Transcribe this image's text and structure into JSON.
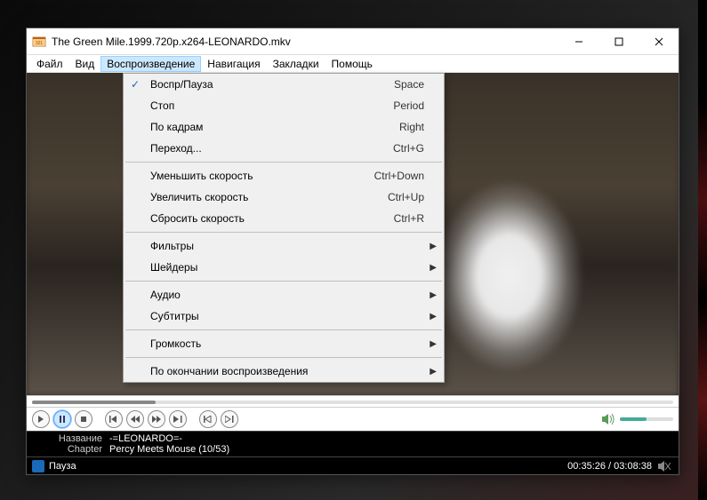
{
  "window": {
    "title": "The Green Mile.1999.720p.x264-LEONARDO.mkv"
  },
  "menubar": {
    "items": [
      {
        "label": "Файл"
      },
      {
        "label": "Вид"
      },
      {
        "label": "Воспроизведение",
        "open": true
      },
      {
        "label": "Навигация"
      },
      {
        "label": "Закладки"
      },
      {
        "label": "Помощь"
      }
    ]
  },
  "dropdown": {
    "groups": [
      [
        {
          "label": "Воспр/Пауза",
          "shortcut": "Space",
          "checked": true
        },
        {
          "label": "Стоп",
          "shortcut": "Period"
        },
        {
          "label": "По кадрам",
          "shortcut": "Right"
        },
        {
          "label": "Переход...",
          "shortcut": "Ctrl+G"
        }
      ],
      [
        {
          "label": "Уменьшить скорость",
          "shortcut": "Ctrl+Down"
        },
        {
          "label": "Увеличить скорость",
          "shortcut": "Ctrl+Up"
        },
        {
          "label": "Сбросить скорость",
          "shortcut": "Ctrl+R"
        }
      ],
      [
        {
          "label": "Фильтры",
          "submenu": true
        },
        {
          "label": "Шейдеры",
          "submenu": true
        }
      ],
      [
        {
          "label": "Аудио",
          "submenu": true
        },
        {
          "label": "Субтитры",
          "submenu": true
        }
      ],
      [
        {
          "label": "Громкость",
          "submenu": true
        }
      ],
      [
        {
          "label": "По окончании воспроизведения",
          "submenu": true
        }
      ]
    ]
  },
  "info": {
    "name_label": "Название",
    "name_value": "-=LEONARDO=-",
    "chapter_label": "Chapter",
    "chapter_value": "Percy Meets Mouse (10/53)"
  },
  "status": {
    "state": "Пауза",
    "time_current": "00:35:26",
    "time_total": "03:08:38"
  },
  "playback": {
    "progress_percent": 19,
    "volume_percent": 50
  },
  "colors": {
    "highlight": "#cce8ff",
    "accent": "#1a6ab8"
  }
}
